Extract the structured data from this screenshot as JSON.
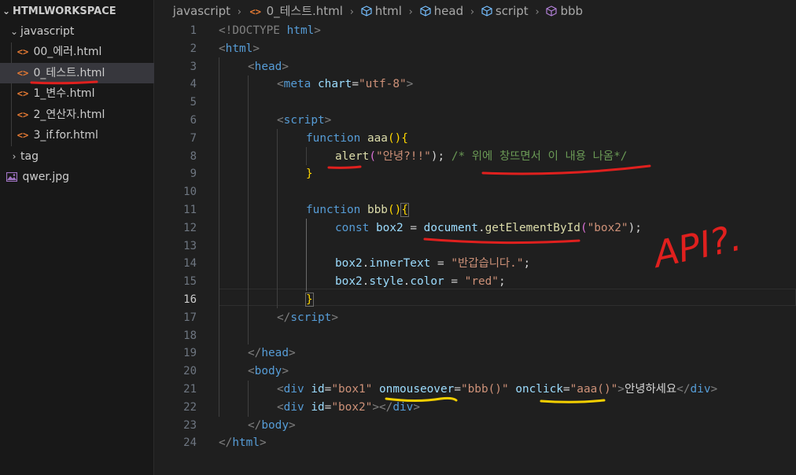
{
  "explorer": {
    "workspace": "HTMLWORKSPACE",
    "folder": "javascript",
    "files": [
      "00_에러.html",
      "0_테스트.html",
      "1_변수.html",
      "2_연산자.html",
      "3_if.for.html"
    ],
    "tag_folder": "tag",
    "image_file": "qwer.jpg"
  },
  "breadcrumb": {
    "items": [
      "javascript",
      "0_테스트.html",
      "html",
      "head",
      "script",
      "bbb"
    ]
  },
  "editor": {
    "line_numbers": [
      "1",
      "2",
      "3",
      "4",
      "5",
      "6",
      "7",
      "8",
      "9",
      "10",
      "11",
      "12",
      "13",
      "14",
      "15",
      "16",
      "17",
      "18",
      "19",
      "20",
      "21",
      "22",
      "23",
      "24"
    ],
    "current_line": "16"
  },
  "code": {
    "l1": {
      "a": "<!DOCTYPE ",
      "b": "html",
      "c": ">"
    },
    "l2": {
      "a": "<",
      "b": "html",
      "c": ">"
    },
    "l3": {
      "a": "<",
      "b": "head",
      "c": ">"
    },
    "l4": {
      "a": "<",
      "b": "meta",
      "c": " ",
      "d": "chart",
      "e": "=",
      "f": "\"utf-8\"",
      "g": ">"
    },
    "l6": {
      "a": "<",
      "b": "script",
      "c": ">"
    },
    "l7": {
      "a": "function",
      "b": " ",
      "c": "aaa",
      "d": "(){"
    },
    "l8": {
      "a": "alert",
      "b": "(",
      "c": "\"안녕?!!\"",
      "d": "); ",
      "e": "/* 위에 창뜨면서 이 내용 나옴*/"
    },
    "l9": {
      "a": "}"
    },
    "l11": {
      "a": "function",
      "b": " ",
      "c": "bbb",
      "d": "()",
      "e": "{"
    },
    "l12": {
      "a": "const",
      "b": " ",
      "c": "box2",
      "d": " = ",
      "e": "document",
      "f": ".",
      "g": "getElementById",
      "h": "(",
      "i": "\"box2\"",
      "j": ");"
    },
    "l14": {
      "a": "box2",
      "b": ".",
      "c": "innerText",
      "d": " = ",
      "e": "\"반갑습니다.\"",
      "f": ";"
    },
    "l15": {
      "a": "box2",
      "b": ".",
      "c": "style",
      "d": ".",
      "e": "color",
      "f": " = ",
      "g": "\"red\"",
      "h": ";"
    },
    "l16": {
      "a": "}"
    },
    "l17": {
      "a": "</",
      "b": "script",
      "c": ">"
    },
    "l19": {
      "a": "</",
      "b": "head",
      "c": ">"
    },
    "l20": {
      "a": "<",
      "b": "body",
      "c": ">"
    },
    "l21": {
      "a": "<",
      "b": "div",
      "c": " ",
      "d": "id",
      "e": "=",
      "f": "\"box1\"",
      "g": " ",
      "h": "onmouseover",
      "i": "=",
      "j": "\"bbb()\"",
      "k": " ",
      "l": "onclick",
      "m": "=",
      "n": "\"aaa()\"",
      "o": ">",
      "p": "안녕하세요",
      "q": "</",
      "r": "div",
      "s": ">"
    },
    "l22": {
      "a": "<",
      "b": "div",
      "c": " ",
      "d": "id",
      "e": "=",
      "f": "\"box2\"",
      "g": "></",
      "h": "div",
      "i": ">"
    },
    "l23": {
      "a": "</",
      "b": "body",
      "c": ">"
    },
    "l24": {
      "a": "</",
      "b": "html",
      "c": ">"
    }
  },
  "handwriting": {
    "note": "API?."
  },
  "colors": {
    "red_ink": "#e0201e",
    "yellow_ink": "#f5d000"
  }
}
